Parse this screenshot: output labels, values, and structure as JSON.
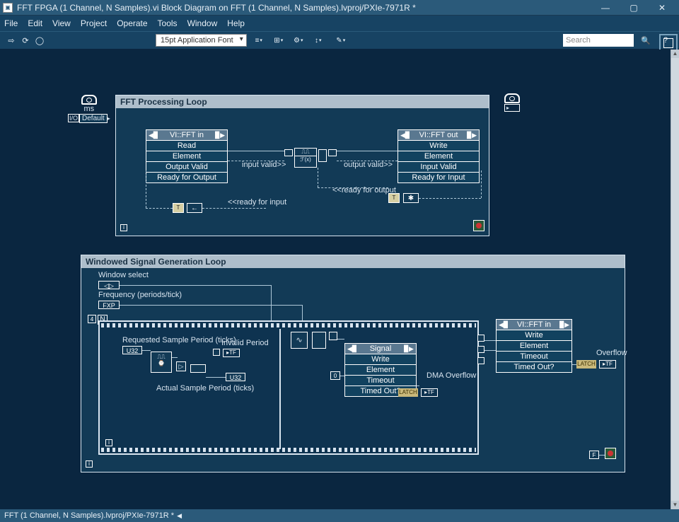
{
  "window": {
    "title": "FFT FPGA (1 Channel, N Samples).vi Block Diagram on FFT (1 Channel, N Samples).lvproj/PXIe-7971R *",
    "min": "—",
    "max": "▢",
    "close": "✕"
  },
  "menu": [
    "File",
    "Edit",
    "View",
    "Project",
    "Operate",
    "Tools",
    "Window",
    "Help"
  ],
  "toolbar": {
    "font": "15pt Application Font",
    "search_placeholder": "Search"
  },
  "status": "FFT (1 Channel, N Samples).lvproj/PXIe-7971R *",
  "loop1": {
    "title": "FFT Processing Loop",
    "in": {
      "name": "VI::FFT in",
      "r1": "Read",
      "r2": "Element",
      "r3": "Output Valid",
      "r4": "Ready for Output"
    },
    "out": {
      "name": "VI::FFT out",
      "r1": "Write",
      "r2": "Element",
      "r3": "Input Valid",
      "r4": "Ready for Input"
    },
    "sig_iv": "input valid>>",
    "sig_ov": "output valid>>",
    "sig_ri": "<<ready for input",
    "sig_ro": "<<ready for output"
  },
  "loop2": {
    "title": "Windowed Signal Generation Loop",
    "winsel": "Window select",
    "freq": "Frequency (periods/tick)",
    "reqper": "Requested Sample Period (ticks)",
    "actper": "Actual Sample Period (ticks)",
    "invalid": "Invalid Period",
    "signal": {
      "name": "Signal",
      "r1": "Write",
      "r2": "Element",
      "r3": "Timeout",
      "r4": "Timed Out?"
    },
    "dma": "DMA Overflow",
    "fftin": {
      "name": "VI::FFT in",
      "r1": "Write",
      "r2": "Element",
      "r3": "Timeout",
      "r4": "Timed Out?"
    },
    "overflow": "Overflow",
    "zero": "0",
    "four": "4"
  },
  "ms": {
    "label": "ms",
    "default": "Default"
  }
}
